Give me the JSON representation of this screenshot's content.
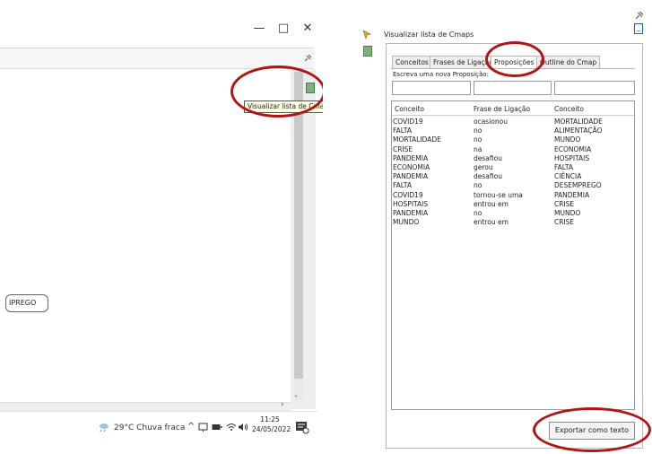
{
  "left_window": {
    "controls": {
      "minimize": "—",
      "maximize": "□",
      "close": "✕"
    },
    "tooltip": "Visualizar lista de Cmaps",
    "node_label": "IPREGO",
    "scroll_arrow_down": "˅",
    "scroll_arrow_right": "›",
    "taskbar": {
      "weather": "29°C  Chuva fraca",
      "tray_chevron": "^",
      "time": "11:25",
      "date": "24/05/2022"
    }
  },
  "right_panel": {
    "title": "Visualizar lista de Cmaps",
    "minimize_label": "_",
    "tabs": [
      {
        "label": "Conceitos",
        "active": false
      },
      {
        "label": "Frases de Ligação",
        "active": false
      },
      {
        "label": "Proposições",
        "active": true
      },
      {
        "label": "Outline do Cmap",
        "active": false
      }
    ],
    "input_label": "Escreva uma nova Proposição:",
    "columns": [
      "Conceito",
      "Frase de Ligação",
      "Conceito"
    ],
    "rows": [
      [
        "COVID19",
        "ocasionou",
        "MORTALIDADE"
      ],
      [
        "FALTA",
        "no",
        "ALIMENTAÇÃO"
      ],
      [
        "MORTALIDADE",
        "no",
        "MUNDO"
      ],
      [
        "CRISE",
        "na",
        "ECONOMIA"
      ],
      [
        "PANDEMIA",
        "desafiou",
        "HOSPITAIS"
      ],
      [
        "ECONOMIA",
        "gerou",
        "FALTA"
      ],
      [
        "PANDEMIA",
        "desafiou",
        "CIÊNCIA"
      ],
      [
        "FALTA",
        "no",
        "DESEMPREGO"
      ],
      [
        "COVID19",
        "tornou-se uma",
        "PANDEMIA"
      ],
      [
        "HOSPITAIS",
        "entrou em",
        "CRISE"
      ],
      [
        "PANDEMIA",
        "no",
        "MUNDO"
      ],
      [
        "MUNDO",
        "entrou em",
        "CRISE"
      ]
    ],
    "export_button": "Exportar como texto"
  },
  "colors": {
    "highlight": "#b21414",
    "tooltip_bg": "#ffffe1",
    "panel_border": "#b8b8b8"
  },
  "icons": [
    "minimize-icon",
    "maximize-icon",
    "close-icon",
    "pin-icon",
    "cmap-list-icon",
    "cloud-rain-icon",
    "network-icon",
    "battery-icon",
    "volume-icon",
    "notification-icon",
    "pointer-icon"
  ]
}
